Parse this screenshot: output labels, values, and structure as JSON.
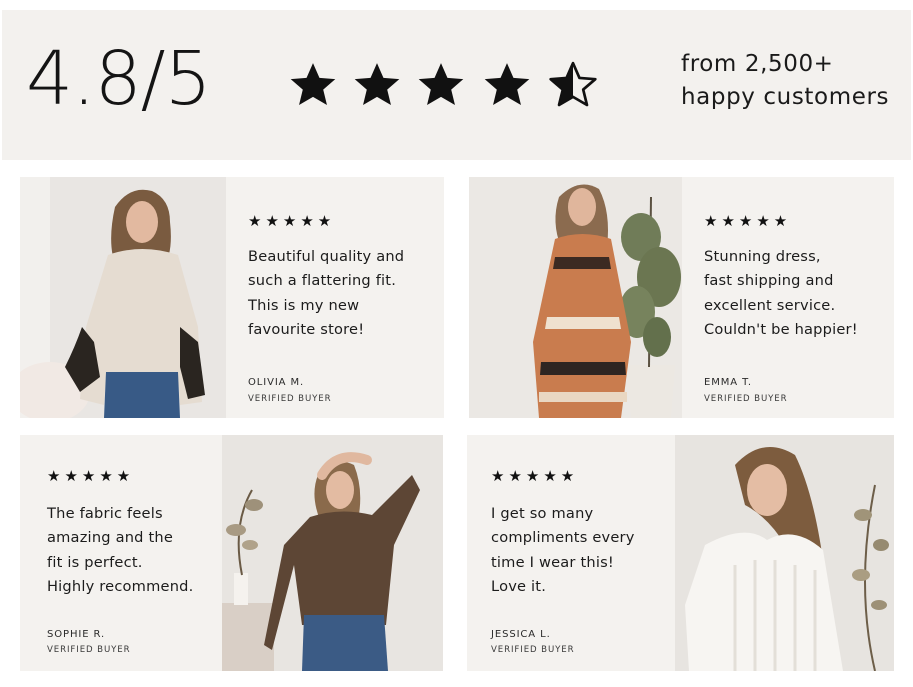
{
  "summary": {
    "score": "4.8/5",
    "rating": 4.5,
    "rating_max": 5,
    "count_line1": "from 2,500+",
    "count_line2": "happy customers"
  },
  "colors": {
    "banner_bg": "#f3f1ee",
    "card_bg": "#f4f2ef",
    "star": "#111111",
    "text": "#1c1c1c"
  },
  "reviews": [
    {
      "stars": "★★★★★",
      "text": "Beautiful quality and\nsuch a flattering fit.\nThis is my new\nfavourite store!",
      "name": "OLIVIA M.",
      "badge": "VERIFIED BUYER"
    },
    {
      "stars": "★★★★★",
      "text": "Stunning dress,\nfast shipping and\nexcellent service.\nCouldn't be happier!",
      "name": "EMMA T.",
      "badge": "VERIFIED BUYER"
    },
    {
      "stars": "★★★★★",
      "text": "The fabric feels\namazing and the\nfit is perfect.\nHighly recommend.",
      "name": "SOPHIE R.",
      "badge": "VERIFIED BUYER"
    },
    {
      "stars": "★★★★★",
      "text": "I get so many\ncompliments every\ntime I wear this!\nLove it.",
      "name": "JESSICA L.",
      "badge": "VERIFIED BUYER"
    }
  ]
}
